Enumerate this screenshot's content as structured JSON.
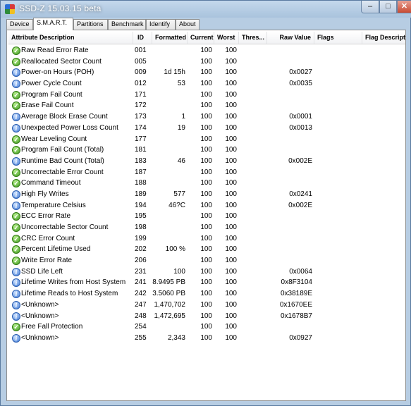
{
  "window": {
    "title": "SSD-Z 15.03.15 beta"
  },
  "tabs": [
    {
      "label": "Device"
    },
    {
      "label": "S.M.A.R.T."
    },
    {
      "label": "Partitions"
    },
    {
      "label": "Benchmark"
    },
    {
      "label": "Identify"
    },
    {
      "label": "About"
    }
  ],
  "columns": {
    "desc": "Attribute Description",
    "id": "ID",
    "formatted": "Formatted",
    "current": "Current",
    "worst": "Worst",
    "threshold": "Thres...",
    "raw": "Raw Value",
    "flags": "Flags",
    "flag_desc": "Flag Descriptio"
  },
  "icons": {
    "ok": "checkmark-icon",
    "info": "info-icon",
    "ok_color": "#3e9a1e",
    "info_color": "#3d79d6"
  },
  "rows": [
    {
      "icon": "ok",
      "desc": "Raw Read Error Rate",
      "id": "001",
      "formatted": "",
      "current": "100",
      "worst": "100",
      "raw": ""
    },
    {
      "icon": "ok",
      "desc": "Reallocated Sector Count",
      "id": "005",
      "formatted": "",
      "current": "100",
      "worst": "100",
      "raw": ""
    },
    {
      "icon": "info",
      "desc": "Power-on Hours (POH)",
      "id": "009",
      "formatted": "1d 15h",
      "current": "100",
      "worst": "100",
      "raw": "0x0027"
    },
    {
      "icon": "info",
      "desc": "Power Cycle Count",
      "id": "012",
      "formatted": "53",
      "current": "100",
      "worst": "100",
      "raw": "0x0035"
    },
    {
      "icon": "ok",
      "desc": "Program Fail Count",
      "id": "171",
      "formatted": "",
      "current": "100",
      "worst": "100",
      "raw": ""
    },
    {
      "icon": "ok",
      "desc": "Erase Fail Count",
      "id": "172",
      "formatted": "",
      "current": "100",
      "worst": "100",
      "raw": ""
    },
    {
      "icon": "info",
      "desc": "Average Block Erase Count",
      "id": "173",
      "formatted": "1",
      "current": "100",
      "worst": "100",
      "raw": "0x0001"
    },
    {
      "icon": "info",
      "desc": "Unexpected Power Loss Count",
      "id": "174",
      "formatted": "19",
      "current": "100",
      "worst": "100",
      "raw": "0x0013"
    },
    {
      "icon": "ok",
      "desc": "Wear Leveling Count",
      "id": "177",
      "formatted": "",
      "current": "100",
      "worst": "100",
      "raw": ""
    },
    {
      "icon": "ok",
      "desc": "Program Fail Count (Total)",
      "id": "181",
      "formatted": "",
      "current": "100",
      "worst": "100",
      "raw": ""
    },
    {
      "icon": "info",
      "desc": "Runtime Bad Count (Total)",
      "id": "183",
      "formatted": "46",
      "current": "100",
      "worst": "100",
      "raw": "0x002E"
    },
    {
      "icon": "ok",
      "desc": "Uncorrectable Error Count",
      "id": "187",
      "formatted": "",
      "current": "100",
      "worst": "100",
      "raw": ""
    },
    {
      "icon": "ok",
      "desc": "Command Timeout",
      "id": "188",
      "formatted": "",
      "current": "100",
      "worst": "100",
      "raw": ""
    },
    {
      "icon": "info",
      "desc": "High Fly Writes",
      "id": "189",
      "formatted": "577",
      "current": "100",
      "worst": "100",
      "raw": "0x0241"
    },
    {
      "icon": "info",
      "desc": "Temperature Celsius",
      "id": "194",
      "formatted": "46?C",
      "current": "100",
      "worst": "100",
      "raw": "0x002E"
    },
    {
      "icon": "ok",
      "desc": "ECC Error Rate",
      "id": "195",
      "formatted": "",
      "current": "100",
      "worst": "100",
      "raw": ""
    },
    {
      "icon": "ok",
      "desc": "Uncorrectable Sector Count",
      "id": "198",
      "formatted": "",
      "current": "100",
      "worst": "100",
      "raw": ""
    },
    {
      "icon": "ok",
      "desc": "CRC Error Count",
      "id": "199",
      "formatted": "",
      "current": "100",
      "worst": "100",
      "raw": ""
    },
    {
      "icon": "ok",
      "desc": "Percent Lifetime Used",
      "id": "202",
      "formatted": "100 %",
      "current": "100",
      "worst": "100",
      "raw": ""
    },
    {
      "icon": "ok",
      "desc": "Write Error Rate",
      "id": "206",
      "formatted": "",
      "current": "100",
      "worst": "100",
      "raw": ""
    },
    {
      "icon": "info",
      "desc": "SSD Life Left",
      "id": "231",
      "formatted": "100",
      "current": "100",
      "worst": "100",
      "raw": "0x0064"
    },
    {
      "icon": "info",
      "desc": "Lifetime Writes from Host System",
      "id": "241",
      "formatted": "8.9495 PB",
      "current": "100",
      "worst": "100",
      "raw": "0x8F3104"
    },
    {
      "icon": "info",
      "desc": "Lifetime Reads to Host System",
      "id": "242",
      "formatted": "3.5060 PB",
      "current": "100",
      "worst": "100",
      "raw": "0x38189E"
    },
    {
      "icon": "info",
      "desc": "<Unknown>",
      "id": "247",
      "formatted": "1,470,702",
      "current": "100",
      "worst": "100",
      "raw": "0x1670EE"
    },
    {
      "icon": "info",
      "desc": "<Unknown>",
      "id": "248",
      "formatted": "1,472,695",
      "current": "100",
      "worst": "100",
      "raw": "0x1678B7"
    },
    {
      "icon": "ok",
      "desc": "Free Fall Protection",
      "id": "254",
      "formatted": "",
      "current": "100",
      "worst": "100",
      "raw": ""
    },
    {
      "icon": "info",
      "desc": "<Unknown>",
      "id": "255",
      "formatted": "2,343",
      "current": "100",
      "worst": "100",
      "raw": "0x0927"
    }
  ]
}
